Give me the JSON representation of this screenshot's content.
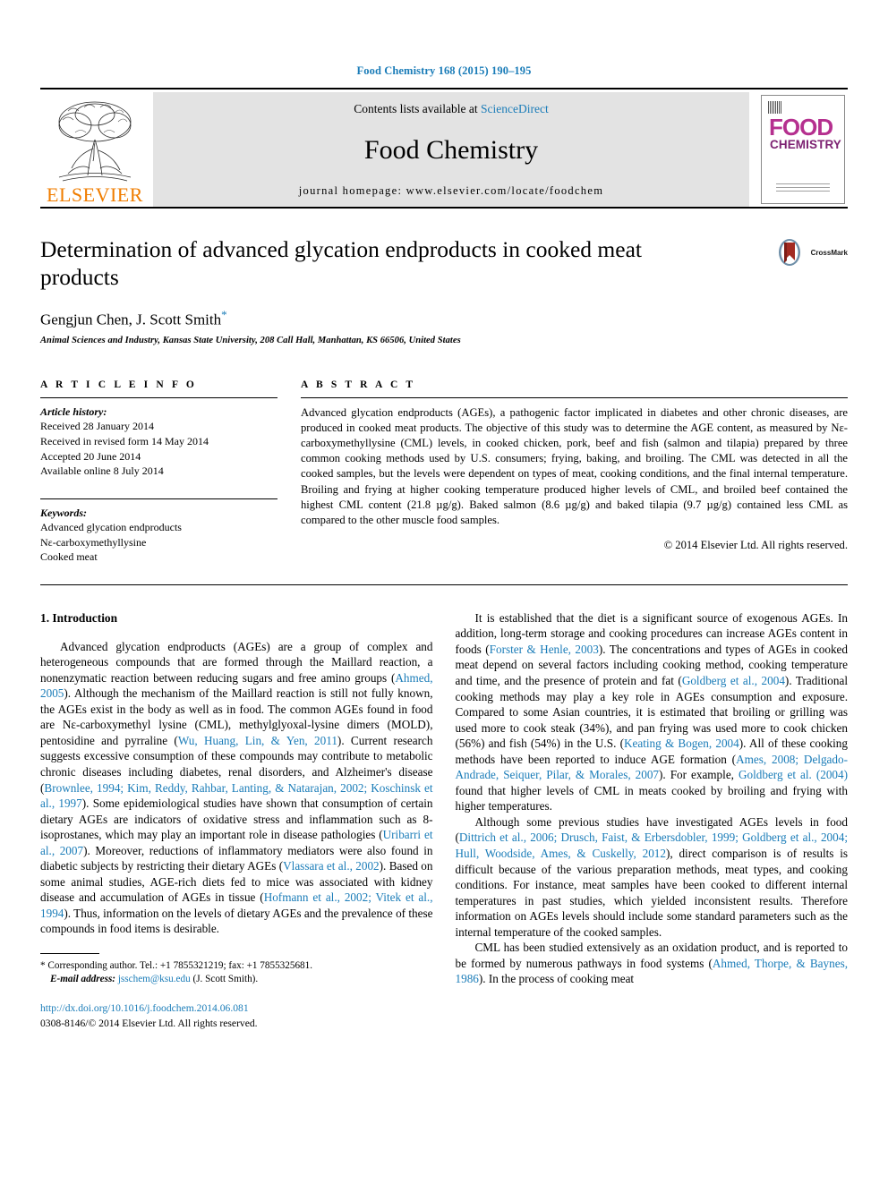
{
  "running_head": "Food Chemistry 168 (2015) 190–195",
  "masthead": {
    "publisher": "ELSEVIER",
    "contents_prefix": "Contents lists available at ",
    "contents_link": "ScienceDirect",
    "journal_name": "Food Chemistry",
    "homepage": "journal homepage: www.elsevier.com/locate/foodchem",
    "cover": {
      "line1": "FOOD",
      "line2": "CHEMISTRY"
    }
  },
  "article": {
    "title": "Determination of advanced glycation endproducts in cooked meat products",
    "authors": "Gengjun Chen, J. Scott Smith",
    "author_marker": "*",
    "affiliation": "Animal Sciences and Industry, Kansas State University, 208 Call Hall, Manhattan, KS 66506, United States",
    "crossmark_label": "CrossMark"
  },
  "article_info": {
    "heading": "A R T I C L E   I N F O",
    "history_label": "Article history:",
    "history": [
      "Received 28 January 2014",
      "Received in revised form 14 May 2014",
      "Accepted 20 June 2014",
      "Available online 8 July 2014"
    ],
    "keywords_label": "Keywords:",
    "keywords": [
      "Advanced glycation endproducts",
      "Nε-carboxymethyllysine",
      "Cooked meat"
    ]
  },
  "abstract": {
    "heading": "A B S T R A C T",
    "text": "Advanced glycation endproducts (AGEs), a pathogenic factor implicated in diabetes and other chronic diseases, are produced in cooked meat products. The objective of this study was to determine the AGE content, as measured by Nε-carboxymethyllysine (CML) levels, in cooked chicken, pork, beef and fish (salmon and tilapia) prepared by three common cooking methods used by U.S. consumers; frying, baking, and broiling. The CML was detected in all the cooked samples, but the levels were dependent on types of meat, cooking conditions, and the final internal temperature. Broiling and frying at higher cooking temperature produced higher levels of CML, and broiled beef contained the highest CML content (21.8 µg/g). Baked salmon (8.6 µg/g) and baked tilapia (9.7 µg/g) contained less CML as compared to the other muscle food samples.",
    "copyright": "© 2014 Elsevier Ltd. All rights reserved."
  },
  "body": {
    "section_heading": "1. Introduction",
    "left_paragraphs": [
      {
        "segments": [
          {
            "t": "Advanced glycation endproducts (AGEs) are a group of complex and heterogeneous compounds that are formed through the Maillard reaction, a nonenzymatic reaction between reducing sugars and free amino groups (",
            "ref": false
          },
          {
            "t": "Ahmed, 2005",
            "ref": true
          },
          {
            "t": "). Although the mechanism of the Maillard reaction is still not fully known, the AGEs exist in the body as well as in food. The common AGEs found in food are Nε-carboxymethyl lysine (CML), methylglyoxal-lysine dimers (MOLD), pentosidine and pyrraline (",
            "ref": false
          },
          {
            "t": "Wu, Huang, Lin, & Yen, 2011",
            "ref": true
          },
          {
            "t": "). Current research suggests excessive consumption of these compounds may contribute to metabolic chronic diseases including diabetes, renal disorders, and Alzheimer's disease (",
            "ref": false
          },
          {
            "t": "Brownlee, 1994; Kim, Reddy, Rahbar, Lanting, & Natarajan, 2002; Koschinsk et al., 1997",
            "ref": true
          },
          {
            "t": "). Some epidemiological studies have shown that consumption of certain dietary AGEs are indicators of oxidative stress and inflammation such as 8-isoprostanes, which may play an important role in disease pathologies (",
            "ref": false
          },
          {
            "t": "Uribarri et al., 2007",
            "ref": true
          },
          {
            "t": "). Moreover, reductions of inflammatory mediators were also found in diabetic subjects by restricting their dietary AGEs (",
            "ref": false
          },
          {
            "t": "Vlassara et al., 2002",
            "ref": true
          },
          {
            "t": "). Based on some animal studies, AGE-rich diets fed to mice was associated with kidney disease and accumulation of AGEs in tissue (",
            "ref": false
          },
          {
            "t": "Hofmann et al., 2002; Vitek et al., 1994",
            "ref": true
          },
          {
            "t": "). Thus, information on the levels of dietary AGEs and the prevalence of these compounds in food items is desirable.",
            "ref": false
          }
        ]
      }
    ],
    "right_paragraphs": [
      {
        "segments": [
          {
            "t": "It is established that the diet is a significant source of exogenous AGEs. In addition, long-term storage and cooking procedures can increase AGEs content in foods (",
            "ref": false
          },
          {
            "t": "Forster & Henle, 2003",
            "ref": true
          },
          {
            "t": "). The concentrations and types of AGEs in cooked meat depend on several factors including cooking method, cooking temperature and time, and the presence of protein and fat (",
            "ref": false
          },
          {
            "t": "Goldberg et al., 2004",
            "ref": true
          },
          {
            "t": "). Traditional cooking methods may play a key role in AGEs consumption and exposure. Compared to some Asian countries, it is estimated that broiling or grilling was used more to cook steak (34%), and pan frying was used more to cook chicken (56%) and fish (54%) in the U.S. (",
            "ref": false
          },
          {
            "t": "Keating & Bogen, 2004",
            "ref": true
          },
          {
            "t": "). All of these cooking methods have been reported to induce AGE formation (",
            "ref": false
          },
          {
            "t": "Ames, 2008; Delgado-Andrade, Seiquer, Pilar, & Morales, 2007",
            "ref": true
          },
          {
            "t": "). For example, ",
            "ref": false
          },
          {
            "t": "Goldberg et al. (2004)",
            "ref": true
          },
          {
            "t": " found that higher levels of CML in meats cooked by broiling and frying with higher temperatures.",
            "ref": false
          }
        ]
      },
      {
        "segments": [
          {
            "t": "Although some previous studies have investigated AGEs levels in food (",
            "ref": false
          },
          {
            "t": "Dittrich et al., 2006; Drusch, Faist, & Erbersdobler, 1999; Goldberg et al., 2004; Hull, Woodside, Ames, & Cuskelly, 2012",
            "ref": true
          },
          {
            "t": "), direct comparison is of results is difficult because of the various preparation methods, meat types, and cooking conditions. For instance, meat samples have been cooked to different internal temperatures in past studies, which yielded inconsistent results. Therefore information on AGEs levels should include some standard parameters such as the internal temperature of the cooked samples.",
            "ref": false
          }
        ]
      },
      {
        "segments": [
          {
            "t": "CML has been studied extensively as an oxidation product, and is reported to be formed by numerous pathways in food systems (",
            "ref": false
          },
          {
            "t": "Ahmed, Thorpe, & Baynes, 1986",
            "ref": true
          },
          {
            "t": "). In the process of cooking meat",
            "ref": false
          }
        ]
      }
    ]
  },
  "footnote": {
    "marker": "*",
    "corresponding": "Corresponding author. Tel.: +1 7855321219; fax: +1 7855325681.",
    "email_label": "E-mail address:",
    "email": "jsschem@ksu.edu",
    "email_suffix": "(J. Scott Smith)."
  },
  "doi_block": {
    "doi": "http://dx.doi.org/10.1016/j.foodchem.2014.06.081",
    "issn_line": "0308-8146/© 2014 Elsevier Ltd. All rights reserved."
  },
  "colors": {
    "link": "#1a7cb8",
    "elsevier_orange": "#f07d00",
    "cover_magenta": "#b5308f",
    "masthead_grey": "#e3e3e3"
  }
}
